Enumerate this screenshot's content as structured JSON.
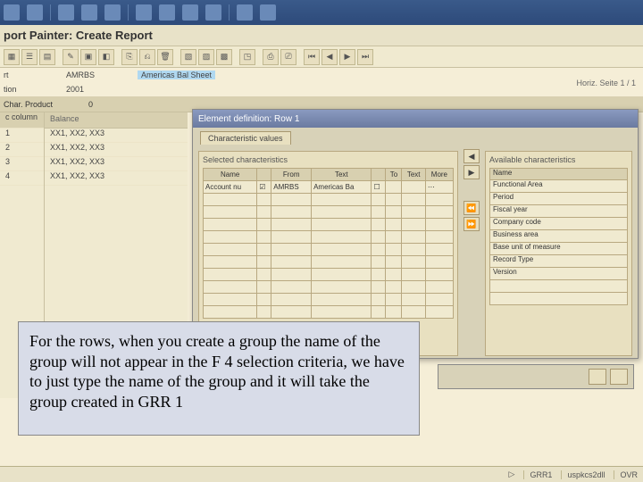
{
  "app": {
    "title": "port Painter: Create Report"
  },
  "info": {
    "report_code": "AMRBS",
    "report_name": "Americas Bal Sheet",
    "year": "2001",
    "horiz": "Horiz. Seite 1 / 1",
    "char_product_label": "Char. Product",
    "char_product_val": "0"
  },
  "columns": {
    "col_label": "c column",
    "balance": "Balance",
    "rows": [
      {
        "n": "1",
        "v": "XX1, XX2, XX3"
      },
      {
        "n": "2",
        "v": "XX1, XX2, XX3"
      },
      {
        "n": "3",
        "v": "XX1, XX2, XX3"
      },
      {
        "n": "4",
        "v": "XX1, XX2, XX3"
      }
    ]
  },
  "dialog": {
    "title": "Element definition: Row 1",
    "tab": "Characteristic values",
    "left_title": "Selected characteristics",
    "right_title": "Available characteristics",
    "headers": {
      "name": "Name",
      "from": "From",
      "text": "Text",
      "to": "To",
      "text2": "Text",
      "more": "More"
    },
    "selected": [
      {
        "name": "Account nu",
        "from": "AMRBS",
        "text": "Americas Ba",
        "to": "",
        "text2": "",
        "more": ""
      }
    ],
    "available": [
      "Name",
      "Functional Area",
      "Period",
      "Fiscal year",
      "Company code",
      "Business area",
      "Base unit of measure",
      "Record Type",
      "Version"
    ]
  },
  "note": "For the rows, when you create a group the name of the group will not appear in the F 4 selection criteria, we have to just type the name of the group and it will take the group created in GRR 1",
  "status": {
    "tx": "GRR1",
    "srv": "uspkcs2dll",
    "mode": "OVR"
  }
}
